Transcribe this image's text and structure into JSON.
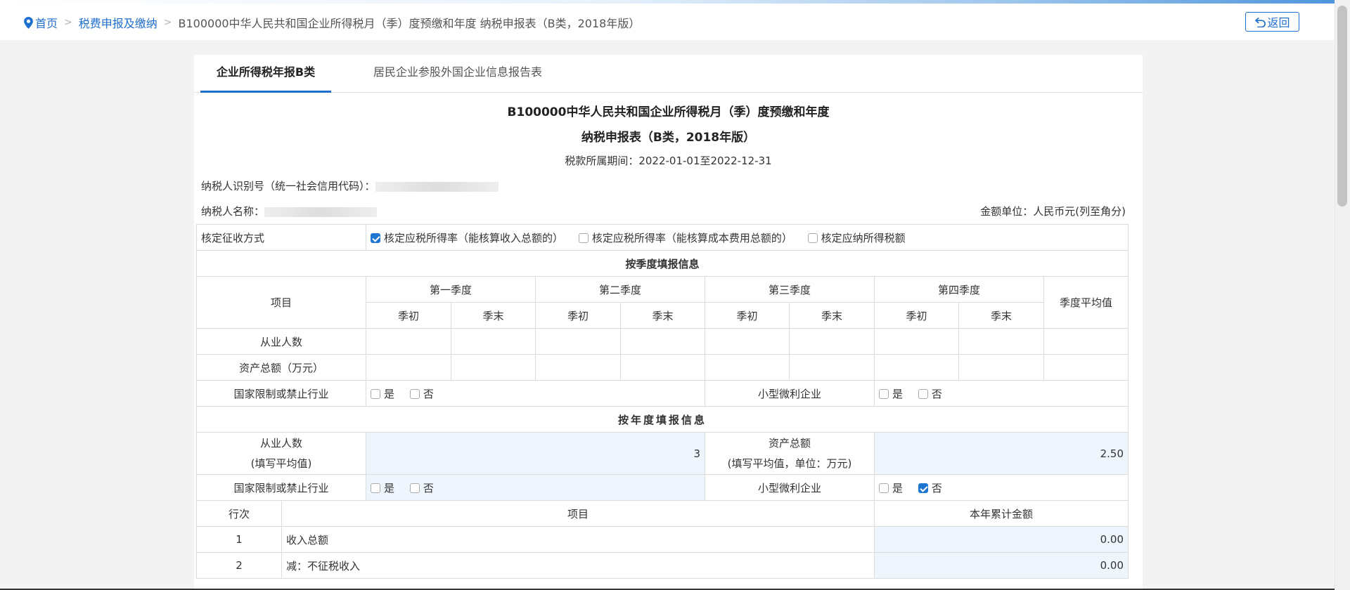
{
  "breadcrumb": {
    "home": "首页",
    "level2": "税费申报及缴纳",
    "current": "B100000中华人民共和国企业所得税月（季）度预缴和年度 纳税申报表（B类，2018年版）"
  },
  "back_label": "返回",
  "tabs": [
    {
      "label": "企业所得税年报B类",
      "active": true
    },
    {
      "label": "居民企业参股外国企业信息报告表",
      "active": false
    }
  ],
  "form": {
    "title_line1": "B100000中华人民共和国企业所得税月（季）度预缴和年度",
    "title_line2": "纳税申报表（B类，2018年版）",
    "period": "税款所属期间：2022-01-01至2022-12-31",
    "taxpayer_id_label": "纳税人识别号（统一社会信用代码）：",
    "taxpayer_name_label": "纳税人名称：",
    "currency_unit": "金额单位：人民币元(列至角分)"
  },
  "assessment": {
    "label": "核定征收方式",
    "options": [
      {
        "label": "核定应税所得率（能核算收入总额的）",
        "checked": true
      },
      {
        "label": "核定应税所得率（能核算成本费用总额的）",
        "checked": false
      },
      {
        "label": "核定应纳所得税额",
        "checked": false
      }
    ]
  },
  "quarterly": {
    "section_title": "按季度填报信息",
    "item_header": "项目",
    "quarters": [
      "第一季度",
      "第二季度",
      "第三季度",
      "第四季度"
    ],
    "start_label": "季初",
    "end_label": "季末",
    "avg_label": "季度平均值",
    "rows": [
      "从业人数",
      "资产总额（万元）"
    ],
    "restricted_label": "国家限制或禁止行业",
    "small_label": "小型微利企业",
    "yes": "是",
    "no": "否"
  },
  "annual": {
    "section_title": "按年度填报信息",
    "employees_label": "从业人数",
    "employees_note": "(填写平均值)",
    "employees_value": "3",
    "assets_label": "资产总额",
    "assets_note": "(填写平均值，单位：万元)",
    "assets_value": "2.50",
    "restricted_label": "国家限制或禁止行业",
    "restricted_yes": false,
    "restricted_no": false,
    "small_label": "小型微利企业",
    "small_yes": false,
    "small_no": true,
    "yes": "是",
    "no": "否"
  },
  "lines": {
    "col_no": "行次",
    "col_item": "项目",
    "col_amount": "本年累计金额",
    "rows": [
      {
        "no": "1",
        "item": "收入总额",
        "amount": "0.00"
      },
      {
        "no": "2",
        "item": "减：不征税收入",
        "amount": "0.00"
      }
    ]
  },
  "colors": {
    "accent": "#1f6fcc",
    "input_bg": "#eef5fd",
    "value_text": "#2f86d4"
  }
}
